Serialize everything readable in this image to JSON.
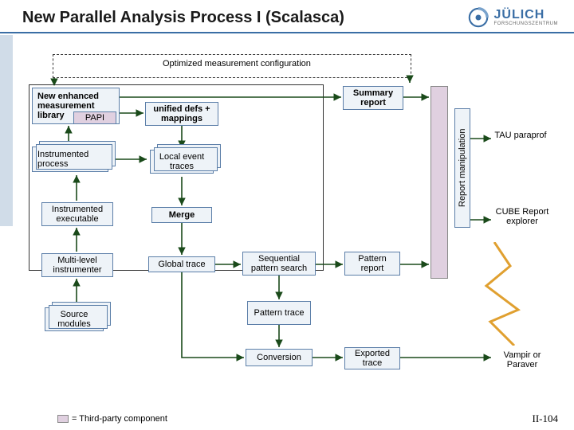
{
  "header": {
    "title": "New Parallel Analysis Process I (Scalasca)",
    "logo_main": "JÜLICH",
    "logo_sub": "FORSCHUNGSZENTRUM"
  },
  "dashed_label": "Optimized measurement configuration",
  "nodes": {
    "meas_lib": "New enhanced measurement library",
    "papi": "PAPI",
    "unified": "unified defs + mappings",
    "summary": "Summary report",
    "instr_proc": "Instrumented process",
    "local_traces": "Local event traces",
    "instr_exec": "Instrumented executable",
    "merge": "Merge",
    "multi_level": "Multi-level instrumenter",
    "global_trace": "Global trace",
    "seq_search": "Sequential pattern search",
    "pattern_report": "Pattern report",
    "source_modules": "Source modules",
    "pattern_trace": "Pattern trace",
    "conversion": "Conversion",
    "exported_trace": "Exported trace"
  },
  "vertical": "Report  manipulation",
  "ext": {
    "tau": "TAU paraprof",
    "cube": "CUBE Report explorer",
    "vampir": "Vampir or Paraver"
  },
  "legend": "= Third-party component",
  "page": "II-104"
}
